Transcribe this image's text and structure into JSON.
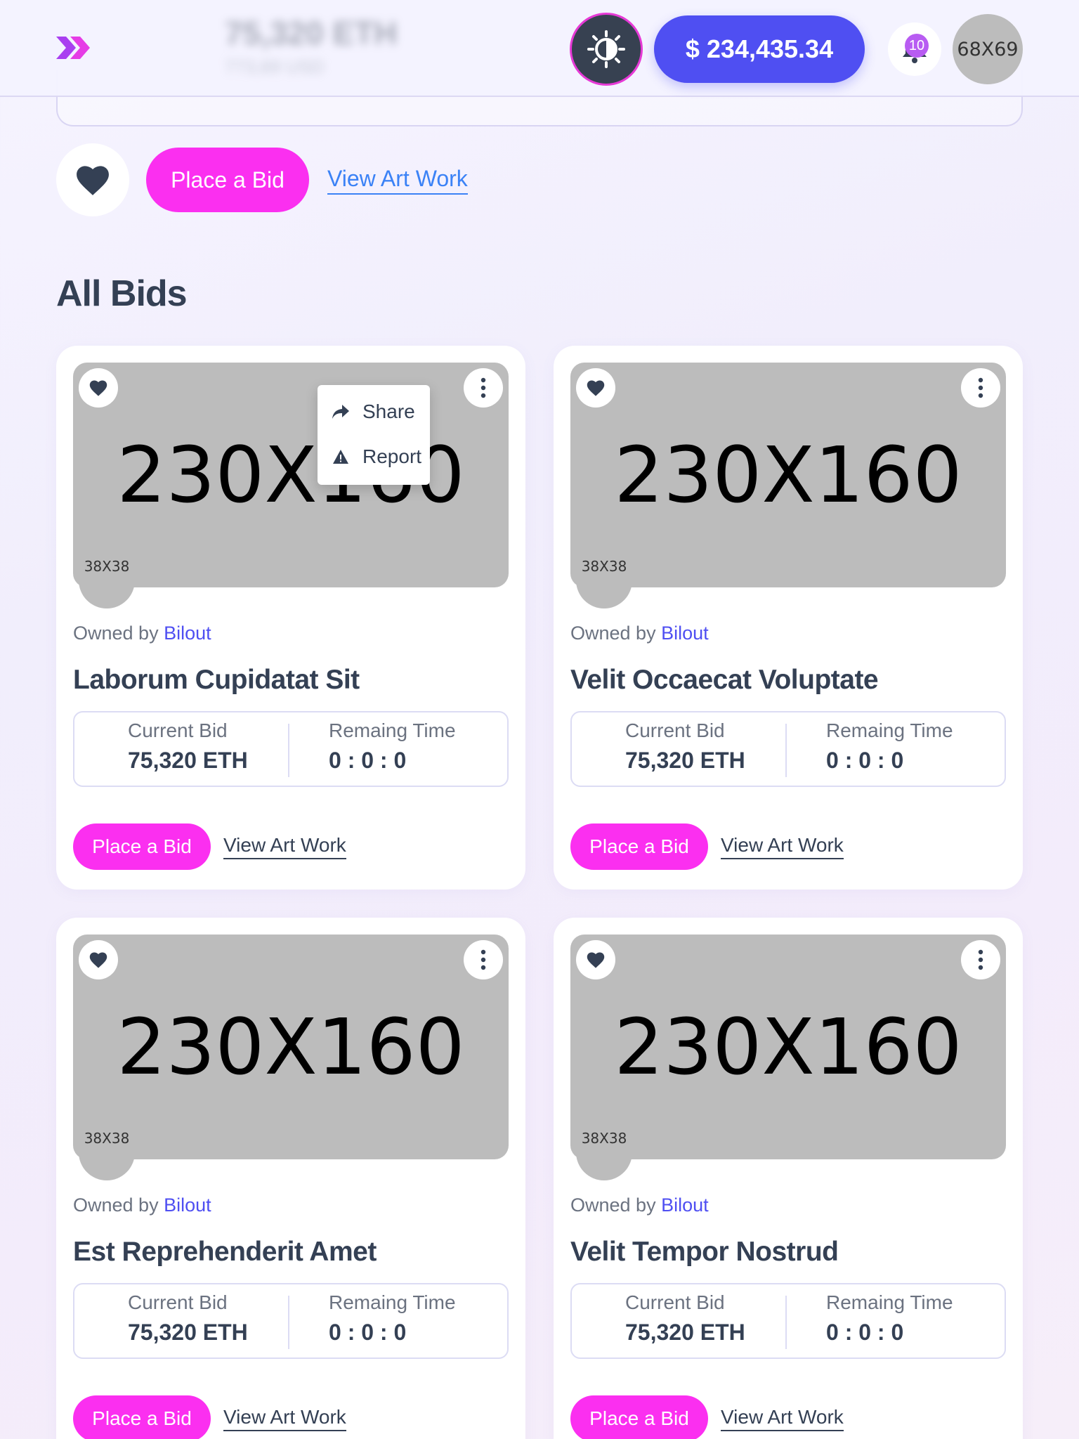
{
  "header": {
    "blurred_amount": "75,320 ETH",
    "blurred_usd": "773,69 USD",
    "balance": "$ 234,435.34",
    "notification_count": "10",
    "avatar_placeholder": "68X69"
  },
  "hero_actions": {
    "place_bid_label": "Place a Bid",
    "view_art_label": "View Art Work"
  },
  "section_title": "All Bids",
  "dropdown": {
    "share_label": "Share",
    "report_label": "Report"
  },
  "colors": {
    "accent_blue": "#4f4ff2",
    "accent_pink": "#fb2ff0",
    "dark": "#344054",
    "placeholder_gray": "#bcbcbc"
  },
  "cards": [
    {
      "image_placeholder": "230X160",
      "owner_avatar": "38X38",
      "owned_prefix": "Owned by",
      "owner": "Bilout",
      "title": "Laborum Cupidatat Sit",
      "current_bid_label": "Current Bid",
      "current_bid": "75,320 ETH",
      "remaining_label": "Remaing Time",
      "remaining": "0 : 0 : 0",
      "place_bid_label": "Place a Bid",
      "view_art_label": "View Art Work"
    },
    {
      "image_placeholder": "230X160",
      "owner_avatar": "38X38",
      "owned_prefix": "Owned by",
      "owner": "Bilout",
      "title": "Velit Occaecat Voluptate",
      "current_bid_label": "Current Bid",
      "current_bid": "75,320 ETH",
      "remaining_label": "Remaing Time",
      "remaining": "0 : 0 : 0",
      "place_bid_label": "Place a Bid",
      "view_art_label": "View Art Work"
    },
    {
      "image_placeholder": "230X160",
      "owner_avatar": "38X38",
      "owned_prefix": "Owned by",
      "owner": "Bilout",
      "title": "Est Reprehenderit Amet",
      "current_bid_label": "Current Bid",
      "current_bid": "75,320 ETH",
      "remaining_label": "Remaing Time",
      "remaining": "0 : 0 : 0",
      "place_bid_label": "Place a Bid",
      "view_art_label": "View Art Work"
    },
    {
      "image_placeholder": "230X160",
      "owner_avatar": "38X38",
      "owned_prefix": "Owned by",
      "owner": "Bilout",
      "title": "Velit Tempor Nostrud",
      "current_bid_label": "Current Bid",
      "current_bid": "75,320 ETH",
      "remaining_label": "Remaing Time",
      "remaining": "0 : 0 : 0",
      "place_bid_label": "Place a Bid",
      "view_art_label": "View Art Work"
    }
  ]
}
